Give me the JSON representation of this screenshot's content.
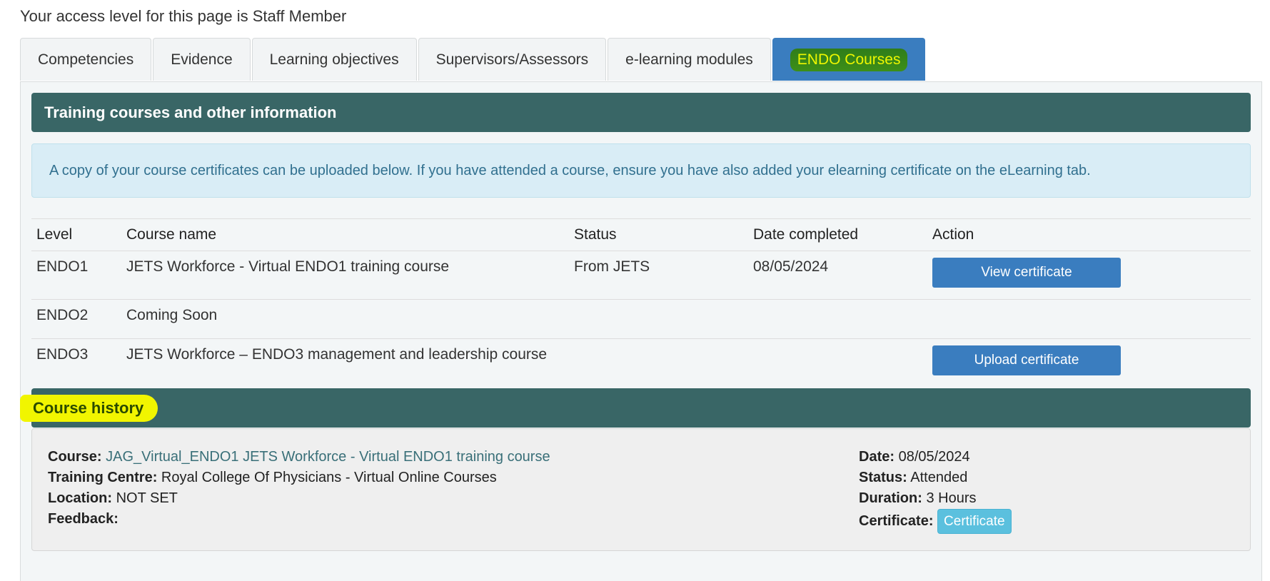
{
  "access_text": "Your access level for this page is Staff Member",
  "tabs": [
    {
      "label": "Competencies"
    },
    {
      "label": "Evidence"
    },
    {
      "label": "Learning objectives"
    },
    {
      "label": "Supervisors/Assessors"
    },
    {
      "label": "e-learning modules"
    },
    {
      "label": "ENDO Courses",
      "active": true
    }
  ],
  "section1": {
    "title": "Training courses and other information",
    "info": "A copy of your course certificates can be uploaded below. If you have attended a course, ensure you have also added your elearning certificate on the eLearning tab."
  },
  "table": {
    "headers": [
      "Level",
      "Course name",
      "Status",
      "Date completed",
      "Action"
    ],
    "rows": [
      {
        "level": "ENDO1",
        "course": "JETS Workforce - Virtual ENDO1 training course",
        "status": "From JETS",
        "date": "08/05/2024",
        "action": "View certificate"
      },
      {
        "level": "ENDO2",
        "course": "Coming Soon",
        "status": "",
        "date": "",
        "action": ""
      },
      {
        "level": "ENDO3",
        "course": "JETS Workforce – ENDO3 management and leadership course",
        "status": "",
        "date": "",
        "action": "Upload certificate"
      }
    ]
  },
  "section2": {
    "title": "Course history"
  },
  "history": {
    "course_label": "Course:",
    "course_value": "JAG_Virtual_ENDO1 JETS Workforce - Virtual ENDO1 training course",
    "centre_label": "Training Centre:",
    "centre_value": "Royal College Of Physicians - Virtual Online Courses",
    "location_label": "Location:",
    "location_value": "NOT SET",
    "feedback_label": "Feedback:",
    "date_label": "Date:",
    "date_value": "08/05/2024",
    "status_label": "Status:",
    "status_value": "Attended",
    "duration_label": "Duration:",
    "duration_value": "3 Hours",
    "certificate_label": "Certificate:",
    "certificate_button": "Certificate"
  },
  "colors": {
    "header_bg": "#396666",
    "tab_active_bg": "#3a7dbf",
    "button_bg": "#3a7dbf",
    "info_bg": "#d9edf6",
    "highlight": "#f1f500"
  }
}
